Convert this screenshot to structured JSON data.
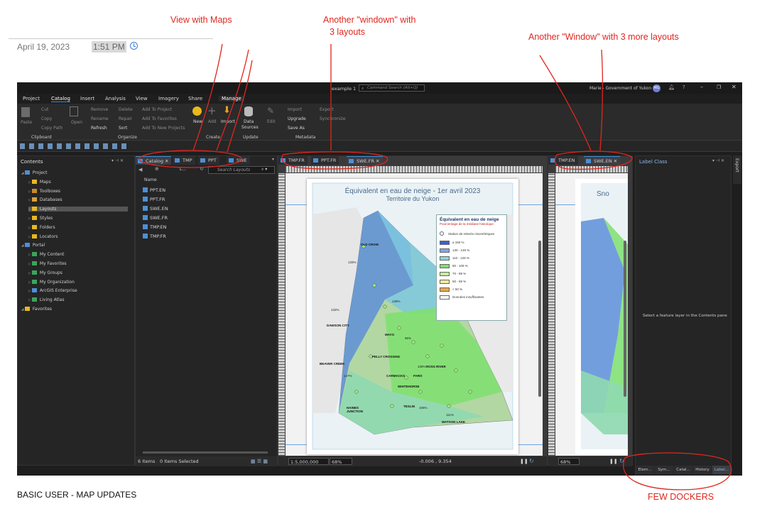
{
  "header": {
    "date": "April 19, 2023",
    "time": "1:51 PM"
  },
  "annotations": {
    "view_with_maps": "View with Maps",
    "window_1_line1": "Another \"windown\" with",
    "window_1_line2": "3 layouts",
    "window_2": "Another \"Window\" with 3 more layouts",
    "few_dockers": "FEW DOCKERS",
    "footer": "BASIC USER - MAP UPDATES",
    "color": "#e0261e"
  },
  "app": {
    "title": "example 1",
    "search_placeholder": "Command Search (Alt+Q)",
    "user": "Marie - Government of Yukon",
    "user_initials": "MG",
    "menus": [
      "Project",
      "Catalog",
      "Insert",
      "Analysis",
      "View",
      "Imagery",
      "Share",
      "Manage"
    ],
    "ribbon": {
      "paste": "Paste",
      "cut": "Cut",
      "copy": "Copy",
      "copy_path": "Copy Path",
      "open": "Open",
      "remove": "Remove",
      "rename": "Rename",
      "refresh": "Refresh",
      "delete": "Delete",
      "repair": "Repair",
      "sort": "Sort",
      "add_to_project": "Add To Project",
      "add_to_favorites": "Add To Favorites",
      "add_to_new_projects": "Add To New Projects",
      "new": "New",
      "add": "Add",
      "import": "Import",
      "data_sources_1": "Data",
      "data_sources_2": "Sources",
      "edit": "Edit",
      "import2": "Import",
      "upgrade": "Upgrade",
      "save_as": "Save As",
      "export": "Export",
      "synchronize": "Synchronize",
      "groups": [
        "Clipboard",
        "Organize",
        "Create",
        "Update",
        "Metadata"
      ]
    },
    "contents": {
      "title": "Contents",
      "items": [
        {
          "label": "Project",
          "indent": 0
        },
        {
          "label": "Maps",
          "indent": 1
        },
        {
          "label": "Toolboxes",
          "indent": 1
        },
        {
          "label": "Databases",
          "indent": 1
        },
        {
          "label": "Layouts",
          "indent": 1
        },
        {
          "label": "Styles",
          "indent": 1
        },
        {
          "label": "Folders",
          "indent": 1
        },
        {
          "label": "Locators",
          "indent": 1
        },
        {
          "label": "Portal",
          "indent": 0
        },
        {
          "label": "My Content",
          "indent": 1
        },
        {
          "label": "My Favorites",
          "indent": 1
        },
        {
          "label": "My Groups",
          "indent": 1
        },
        {
          "label": "My Organization",
          "indent": 1
        },
        {
          "label": "ArcGIS Enterprise",
          "indent": 1
        },
        {
          "label": "Living Atlas",
          "indent": 1
        },
        {
          "label": "Favorites",
          "indent": 0
        }
      ]
    },
    "catalog": {
      "tabs": [
        "Catalog",
        "TMP",
        "PPT",
        "SWE"
      ],
      "search_placeholder": "Search Layouts",
      "breadcrumb": "L...",
      "column": "Name",
      "items": [
        "PPT.EN",
        "PPT.FR",
        "SWE.EN",
        "SWE.FR",
        "TMP.EN",
        "TMP.FR"
      ],
      "count": "6 Items",
      "selected": "0 Items Selected"
    },
    "layout1": {
      "tabs": [
        "TMP.FR",
        "PPT.FR",
        "SWE.FR"
      ],
      "scale": "1:5,000,000",
      "zoom": "68%",
      "coords": "-0.006 , 9.354"
    },
    "layout2": {
      "tabs": [
        "TMP.EN",
        "SWE.EN"
      ],
      "zoom": "68%",
      "partial_title": "Sno"
    },
    "label_class": {
      "title": "Label Class",
      "message": "Select a feature layer in the Contents pane",
      "tabs": [
        "Elem...",
        "Sym...",
        "Catal...",
        "History",
        "Label..."
      ],
      "side_tab": "Export"
    },
    "map": {
      "title_line1": "Équivalent en eau de neige - 1er avril 2023",
      "title_line2": "Territoire du Yukon",
      "legend_title": "Équivalent en eau de neige",
      "legend_subtitle": "Pourcentage de la médiane historique",
      "legend_station": "Station de relevés nivométriques",
      "legend_items": [
        {
          "label": "≥ 150 %",
          "color": "#3d5ed8"
        },
        {
          "label": "130 - 149 %",
          "color": "#7fa7e8"
        },
        {
          "label": "110 - 129 %",
          "color": "#8ad9d9"
        },
        {
          "label": "90 - 109 %",
          "color": "#7ee06f"
        },
        {
          "label": "70 - 89 %",
          "color": "#c5ef9a"
        },
        {
          "label": "50 - 69 %",
          "color": "#f2eb9a"
        },
        {
          "label": "< 50 %",
          "color": "#e8a74a"
        },
        {
          "label": "Données insuffisantes",
          "color": "#ffffff"
        }
      ],
      "places": [
        "OLD CROW",
        "DAWSON CITY",
        "MAYO",
        "PELLY CROSSING",
        "CARMACKS",
        "FARO",
        "ROSS RIVER",
        "BEAVER CREEK",
        "WHITEHORSE",
        "TESLIN",
        "WATSON LAKE",
        "HAINES JUNCTION"
      ],
      "percents": [
        "133%",
        "128%",
        "132%",
        "147%",
        "96%",
        "108%",
        "106%",
        "111%"
      ]
    }
  }
}
